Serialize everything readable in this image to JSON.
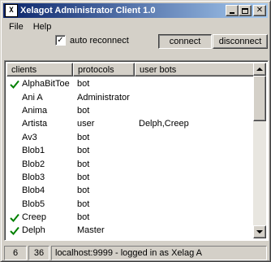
{
  "window": {
    "title": "Xelagot Administrator Client 1.0",
    "app_icon_text": "X",
    "buttons": {
      "minimize": "_",
      "maximize": "□",
      "close": "✕"
    }
  },
  "menu": [
    {
      "label": "File"
    },
    {
      "label": "Help"
    }
  ],
  "toolbar": {
    "auto_reconnect_label": "auto reconnect",
    "auto_reconnect_checked": true,
    "connect_label": "connect",
    "disconnect_label": "disconnect"
  },
  "list": {
    "columns": [
      "clients",
      "protocols",
      "user bots"
    ],
    "rows": [
      {
        "client": "AlphaBitToe",
        "protocol": "bot",
        "user_bots": "",
        "checked": true
      },
      {
        "client": "Ani A",
        "protocol": "Administrator",
        "user_bots": "",
        "checked": false
      },
      {
        "client": "Anima",
        "protocol": "bot",
        "user_bots": "",
        "checked": false
      },
      {
        "client": "Artista",
        "protocol": "user",
        "user_bots": "Delph,Creep",
        "checked": false
      },
      {
        "client": "Av3",
        "protocol": "bot",
        "user_bots": "",
        "checked": false
      },
      {
        "client": "Blob1",
        "protocol": "bot",
        "user_bots": "",
        "checked": false
      },
      {
        "client": "Blob2",
        "protocol": "bot",
        "user_bots": "",
        "checked": false
      },
      {
        "client": "Blob3",
        "protocol": "bot",
        "user_bots": "",
        "checked": false
      },
      {
        "client": "Blob4",
        "protocol": "bot",
        "user_bots": "",
        "checked": false
      },
      {
        "client": "Blob5",
        "protocol": "bot",
        "user_bots": "",
        "checked": false
      },
      {
        "client": "Creep",
        "protocol": "bot",
        "user_bots": "",
        "checked": true
      },
      {
        "client": "Delph",
        "protocol": "Master",
        "user_bots": "",
        "checked": true
      }
    ],
    "check_color": "#008000"
  },
  "status": {
    "count1": "6",
    "count2": "36",
    "message": "localhost:9999 - logged in as Xelag A"
  }
}
